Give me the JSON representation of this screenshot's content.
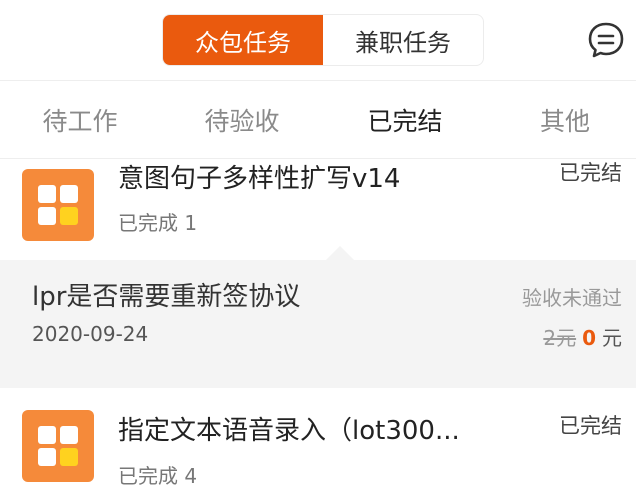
{
  "header": {
    "segments": [
      "众包任务",
      "兼职任务"
    ],
    "active_segment": "众包任务",
    "chat_icon": "chat-bubble-icon"
  },
  "tabs": [
    {
      "label": "待工作"
    },
    {
      "label": "待验收"
    },
    {
      "label": "已完结"
    },
    {
      "label": "其他"
    }
  ],
  "active_tab": "已完结",
  "accent_color": "#ea5a0e",
  "tasks": [
    {
      "title": "意图句子多样性扩写v14",
      "progress": "已完成 1",
      "status": "已完结",
      "icon": "task-grid-icon"
    },
    {
      "title": "lpr是否需要重新签协议",
      "date": "2020-09-24",
      "status": "验收未通过",
      "original_price": "2元",
      "paid_price": "0",
      "unit": "元"
    },
    {
      "title": "指定文本语音录入（lot300...",
      "progress": "已完成 4",
      "status": "已完结",
      "icon": "task-grid-icon"
    }
  ]
}
